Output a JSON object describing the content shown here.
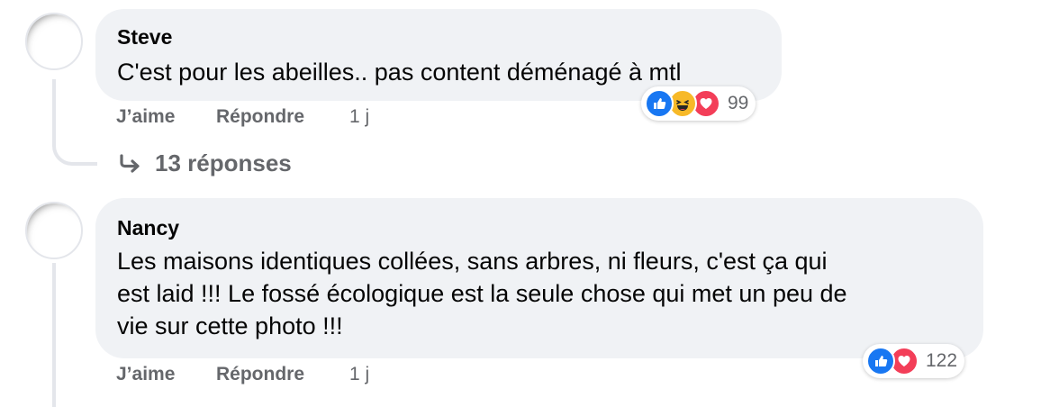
{
  "comments": [
    {
      "author": "Steve",
      "text": "C'est pour les abeilles.. pas content déménagé à mtl",
      "like_label": "J’aime",
      "reply_label": "Répondre",
      "time": "1 j",
      "reaction_count": "99",
      "reactions": [
        "like",
        "haha",
        "love"
      ]
    },
    {
      "author": "Nancy",
      "text_lines": [
        "Les maisons identiques collées, sans arbres, ni fleurs, c'est ça qui",
        "est laid !!! Le fossé écologique est la seule chose qui met un peu de",
        "vie sur cette photo !!!"
      ],
      "like_label": "J’aime",
      "reply_label": "Répondre",
      "time": "1 j",
      "reaction_count": "122",
      "reactions": [
        "like",
        "love"
      ]
    }
  ],
  "replies_link": "13 réponses",
  "colors": {
    "bubble": "#f0f2f5",
    "secondary_text": "#65676b",
    "like": "#1877f2",
    "love": "#f33e58",
    "haha": "#f7b928"
  }
}
